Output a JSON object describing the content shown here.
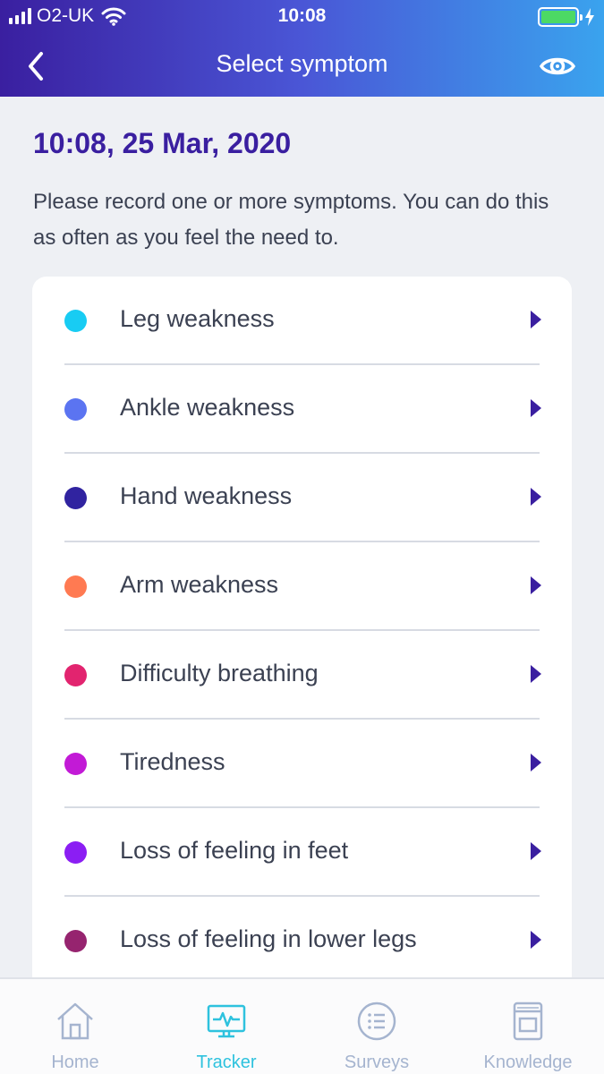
{
  "status_bar": {
    "carrier": "O2-UK",
    "time": "10:08",
    "battery_color": "#4cd964"
  },
  "nav": {
    "title": "Select symptom",
    "back_icon": "chevron-left-icon",
    "right_icon": "eye-icon"
  },
  "main": {
    "date": "10:08, 25 Mar, 2020",
    "intro": "Please record one or more symptoms. You can do this as often as you feel the need to."
  },
  "symptoms": [
    {
      "label": "Leg weakness",
      "color": "#18ccf3"
    },
    {
      "label": "Ankle weakness",
      "color": "#5b74f1"
    },
    {
      "label": "Hand weakness",
      "color": "#3023a0"
    },
    {
      "label": "Arm weakness",
      "color": "#ff7a52"
    },
    {
      "label": "Difficulty breathing",
      "color": "#e2246f"
    },
    {
      "label": "Tiredness",
      "color": "#c21ad6"
    },
    {
      "label": "Loss of feeling in feet",
      "color": "#8b1ef3"
    },
    {
      "label": "Loss of feeling in lower legs",
      "color": "#96246f"
    }
  ],
  "tabbar": {
    "tabs": [
      {
        "label": "Home",
        "icon": "home-icon",
        "active": false
      },
      {
        "label": "Tracker",
        "icon": "tracker-monitor-icon",
        "active": true
      },
      {
        "label": "Surveys",
        "icon": "list-icon",
        "active": false
      },
      {
        "label": "Knowledge",
        "icon": "book-icon",
        "active": false
      }
    ],
    "active_color": "#2ec2de",
    "inactive_color": "#a5b4cf"
  },
  "colors": {
    "primary": "#3a1fa0",
    "header_gradient_end": "#3aa3ee"
  }
}
